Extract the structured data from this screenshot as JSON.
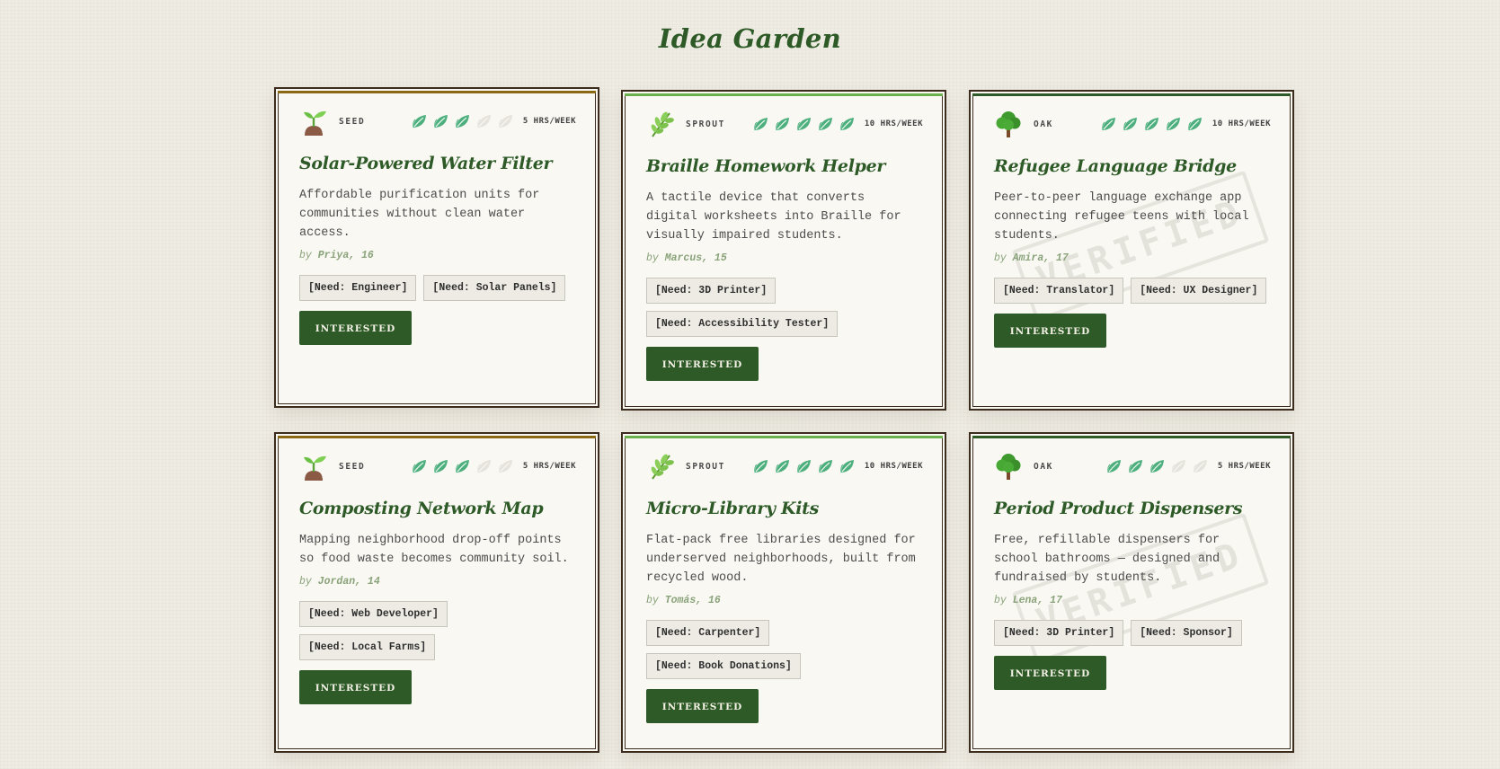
{
  "page": {
    "title": "Idea Garden"
  },
  "colors": {
    "seed": "#8b6914",
    "sprout": "#6ab04c",
    "oak": "#2d5a27",
    "leaf_active": "#4caf7d",
    "leaf_inactive": "#e6e3dc",
    "button": "#2d5a27"
  },
  "ideas": [
    {
      "stage": "SEED",
      "stage_icon": "seedling-icon",
      "hours": "5 HRS/WEEK",
      "leaf_level": 3,
      "leaf_max": 5,
      "title": "Solar-Powered Water Filter",
      "description": "Affordable purification units for communities without clean water access.",
      "author_prefix": "by",
      "author": "Priya, 16",
      "needs": [
        "[Need: Engineer]",
        "[Need: Solar Panels]"
      ],
      "button": "INTERESTED",
      "verified": false,
      "stamp": ""
    },
    {
      "stage": "SPROUT",
      "stage_icon": "herb-icon",
      "hours": "10 HRS/WEEK",
      "leaf_level": 5,
      "leaf_max": 5,
      "title": "Braille Homework Helper",
      "description": "A tactile device that converts digital worksheets into Braille for visually impaired students.",
      "author_prefix": "by",
      "author": "Marcus, 15",
      "needs": [
        "[Need: 3D Printer]",
        "[Need: Accessibility Tester]"
      ],
      "button": "INTERESTED",
      "verified": false,
      "stamp": ""
    },
    {
      "stage": "OAK",
      "stage_icon": "tree-icon",
      "hours": "10 HRS/WEEK",
      "leaf_level": 5,
      "leaf_max": 5,
      "title": "Refugee Language Bridge",
      "description": "Peer-to-peer language exchange app connecting refugee teens with local students.",
      "author_prefix": "by",
      "author": "Amira, 17",
      "needs": [
        "[Need: Translator]",
        "[Need: UX Designer]"
      ],
      "button": "INTERESTED",
      "verified": true,
      "stamp": "VERIFIED"
    },
    {
      "stage": "SEED",
      "stage_icon": "seedling-icon",
      "hours": "5 HRS/WEEK",
      "leaf_level": 3,
      "leaf_max": 5,
      "title": "Composting Network Map",
      "description": "Mapping neighborhood drop-off points so food waste becomes community soil.",
      "author_prefix": "by",
      "author": "Jordan, 14",
      "needs": [
        "[Need: Web Developer]",
        "[Need: Local Farms]"
      ],
      "button": "INTERESTED",
      "verified": false,
      "stamp": ""
    },
    {
      "stage": "SPROUT",
      "stage_icon": "herb-icon",
      "hours": "10 HRS/WEEK",
      "leaf_level": 5,
      "leaf_max": 5,
      "title": "Micro-Library Kits",
      "description": "Flat-pack free libraries designed for underserved neighborhoods, built from recycled wood.",
      "author_prefix": "by",
      "author": "Tomás, 16",
      "needs": [
        "[Need: Carpenter]",
        "[Need: Book Donations]"
      ],
      "button": "INTERESTED",
      "verified": false,
      "stamp": ""
    },
    {
      "stage": "OAK",
      "stage_icon": "tree-icon",
      "hours": "5 HRS/WEEK",
      "leaf_level": 3,
      "leaf_max": 5,
      "title": "Period Product Dispensers",
      "description": "Free, refillable dispensers for school bathrooms — designed and fundraised by students.",
      "author_prefix": "by",
      "author": "Lena, 17",
      "needs": [
        "[Need: 3D Printer]",
        "[Need: Sponsor]"
      ],
      "button": "INTERESTED",
      "verified": true,
      "stamp": "VERIFIED"
    }
  ]
}
